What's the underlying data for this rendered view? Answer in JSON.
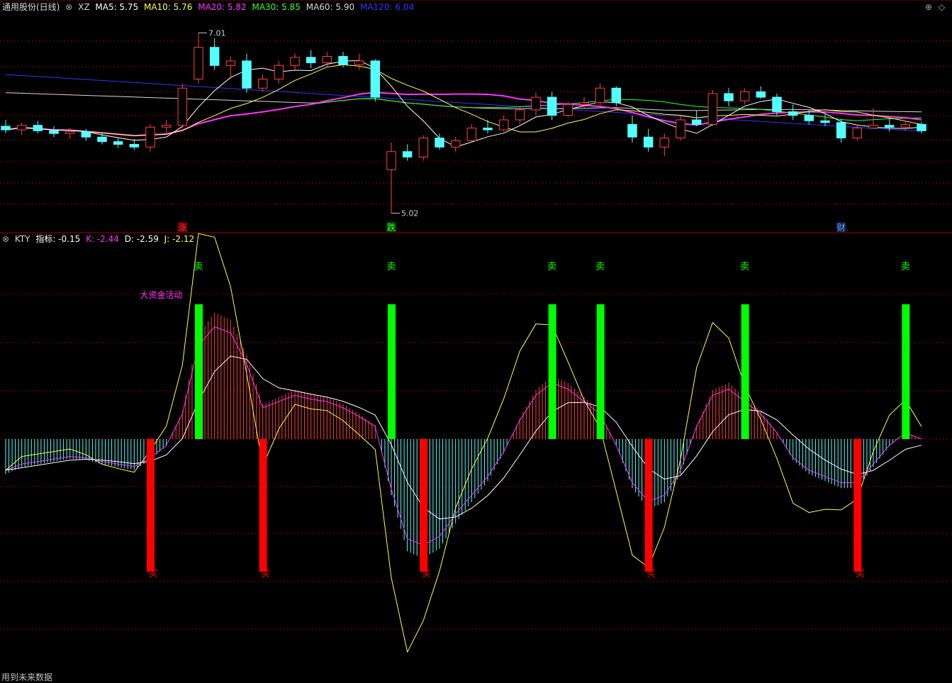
{
  "app": {
    "stock_name": "通用股份(日线)",
    "footer_note": "用到未来数据"
  },
  "main_header": {
    "close_glyph": "⊗",
    "indicator": "XZ",
    "mas": [
      {
        "label": "MA5: 5.75",
        "color": "#ffffff"
      },
      {
        "label": "MA10: 5.76",
        "color": "#ffff44"
      },
      {
        "label": "MA20: 5.82",
        "color": "#ff33ff"
      },
      {
        "label": "MA30: 5.85",
        "color": "#33ff33"
      },
      {
        "label": "MA60: 5.90",
        "color": "#d8d8d8"
      },
      {
        "label": "MA120: 6.04",
        "color": "#3333ff"
      }
    ],
    "corner_icons": [
      "⊕",
      "◇"
    ]
  },
  "price_annotations": {
    "high": "7.01",
    "low": "5.02"
  },
  "event_markers": [
    {
      "label": "涨",
      "color": "#ff3333",
      "bg": "#5a0000",
      "index": 11
    },
    {
      "label": "跌",
      "color": "#33ff33",
      "bg": "#004400",
      "index": 24
    },
    {
      "label": "财",
      "color": "#66aaff",
      "bg": "#0a1f44",
      "index": 52
    }
  ],
  "indicator_header": {
    "close_glyph": "⊗",
    "name": "KTY",
    "fields": [
      {
        "label": "指标: -0.15",
        "color": "#ffffff"
      },
      {
        "label": "K: -2.44",
        "color": "#ff33ff"
      },
      {
        "label": "D: -2.59",
        "color": "#ffffff"
      },
      {
        "label": "J: -2.12",
        "color": "#ffff44"
      }
    ]
  },
  "big_capital_label": "大资金活动",
  "signals": {
    "sell_label": "卖",
    "buy_label": "买",
    "sell_at": [
      12,
      24,
      34,
      37,
      46,
      56
    ],
    "buy_at": [
      9,
      16,
      26,
      40,
      53
    ]
  },
  "colors": {
    "up": "#ff4040",
    "down": "#54ffff",
    "grid": "#8b0000",
    "sell_bar": "#00ff00",
    "buy_bar": "#ff0000",
    "big_capital": "#ff33ff"
  },
  "chart_data": {
    "type": "candlestick",
    "ylim": [
      4.9,
      7.2
    ],
    "candles": [
      {
        "o": 5.98,
        "h": 6.05,
        "l": 5.9,
        "c": 5.94
      },
      {
        "o": 5.94,
        "h": 6.02,
        "l": 5.88,
        "c": 5.99
      },
      {
        "o": 5.99,
        "h": 6.04,
        "l": 5.9,
        "c": 5.93
      },
      {
        "o": 5.93,
        "h": 5.98,
        "l": 5.86,
        "c": 5.9
      },
      {
        "o": 5.9,
        "h": 5.96,
        "l": 5.84,
        "c": 5.92
      },
      {
        "o": 5.92,
        "h": 5.95,
        "l": 5.82,
        "c": 5.86
      },
      {
        "o": 5.86,
        "h": 5.9,
        "l": 5.78,
        "c": 5.81
      },
      {
        "o": 5.81,
        "h": 5.86,
        "l": 5.74,
        "c": 5.78
      },
      {
        "o": 5.78,
        "h": 5.84,
        "l": 5.72,
        "c": 5.75
      },
      {
        "o": 5.75,
        "h": 6.0,
        "l": 5.7,
        "c": 5.97
      },
      {
        "o": 5.97,
        "h": 6.05,
        "l": 5.9,
        "c": 5.99
      },
      {
        "o": 5.99,
        "h": 6.45,
        "l": 5.96,
        "c": 6.4
      },
      {
        "o": 6.5,
        "h": 7.01,
        "l": 6.45,
        "c": 6.85
      },
      {
        "o": 6.85,
        "h": 6.95,
        "l": 6.6,
        "c": 6.65
      },
      {
        "o": 6.65,
        "h": 6.75,
        "l": 6.5,
        "c": 6.7
      },
      {
        "o": 6.7,
        "h": 6.78,
        "l": 6.35,
        "c": 6.4
      },
      {
        "o": 6.4,
        "h": 6.55,
        "l": 6.36,
        "c": 6.5
      },
      {
        "o": 6.5,
        "h": 6.7,
        "l": 6.45,
        "c": 6.65
      },
      {
        "o": 6.65,
        "h": 6.78,
        "l": 6.6,
        "c": 6.74
      },
      {
        "o": 6.74,
        "h": 6.82,
        "l": 6.62,
        "c": 6.68
      },
      {
        "o": 6.68,
        "h": 6.8,
        "l": 6.64,
        "c": 6.75
      },
      {
        "o": 6.75,
        "h": 6.8,
        "l": 6.63,
        "c": 6.66
      },
      {
        "o": 6.66,
        "h": 6.78,
        "l": 6.6,
        "c": 6.7
      },
      {
        "o": 6.7,
        "h": 6.72,
        "l": 6.25,
        "c": 6.3
      },
      {
        "o": 5.5,
        "h": 5.8,
        "l": 5.02,
        "c": 5.7
      },
      {
        "o": 5.7,
        "h": 5.78,
        "l": 5.6,
        "c": 5.64
      },
      {
        "o": 5.64,
        "h": 5.88,
        "l": 5.6,
        "c": 5.85
      },
      {
        "o": 5.85,
        "h": 5.9,
        "l": 5.72,
        "c": 5.75
      },
      {
        "o": 5.75,
        "h": 5.86,
        "l": 5.7,
        "c": 5.82
      },
      {
        "o": 5.82,
        "h": 6.0,
        "l": 5.8,
        "c": 5.96
      },
      {
        "o": 5.96,
        "h": 6.05,
        "l": 5.9,
        "c": 5.94
      },
      {
        "o": 5.94,
        "h": 6.1,
        "l": 5.92,
        "c": 6.05
      },
      {
        "o": 6.05,
        "h": 6.2,
        "l": 6.0,
        "c": 6.16
      },
      {
        "o": 6.16,
        "h": 6.35,
        "l": 6.1,
        "c": 6.3
      },
      {
        "o": 6.3,
        "h": 6.36,
        "l": 6.05,
        "c": 6.1
      },
      {
        "o": 6.1,
        "h": 6.25,
        "l": 6.08,
        "c": 6.22
      },
      {
        "o": 6.22,
        "h": 6.3,
        "l": 6.18,
        "c": 6.24
      },
      {
        "o": 6.24,
        "h": 6.45,
        "l": 6.2,
        "c": 6.4
      },
      {
        "o": 6.4,
        "h": 6.42,
        "l": 6.2,
        "c": 6.24
      },
      {
        "o": 6.0,
        "h": 6.1,
        "l": 5.8,
        "c": 5.86
      },
      {
        "o": 5.86,
        "h": 5.95,
        "l": 5.7,
        "c": 5.75
      },
      {
        "o": 5.75,
        "h": 5.9,
        "l": 5.65,
        "c": 5.85
      },
      {
        "o": 5.85,
        "h": 6.1,
        "l": 5.82,
        "c": 6.05
      },
      {
        "o": 6.05,
        "h": 6.15,
        "l": 5.98,
        "c": 6.0
      },
      {
        "o": 6.0,
        "h": 6.38,
        "l": 5.98,
        "c": 6.34
      },
      {
        "o": 6.34,
        "h": 6.4,
        "l": 6.2,
        "c": 6.26
      },
      {
        "o": 6.26,
        "h": 6.4,
        "l": 6.22,
        "c": 6.36
      },
      {
        "o": 6.36,
        "h": 6.42,
        "l": 6.28,
        "c": 6.3
      },
      {
        "o": 6.3,
        "h": 6.34,
        "l": 6.1,
        "c": 6.14
      },
      {
        "o": 6.14,
        "h": 6.22,
        "l": 6.05,
        "c": 6.1
      },
      {
        "o": 6.1,
        "h": 6.16,
        "l": 6.0,
        "c": 6.04
      },
      {
        "o": 6.04,
        "h": 6.12,
        "l": 5.98,
        "c": 6.02
      },
      {
        "o": 6.02,
        "h": 6.06,
        "l": 5.8,
        "c": 5.85
      },
      {
        "o": 5.85,
        "h": 6.0,
        "l": 5.82,
        "c": 5.96
      },
      {
        "o": 5.96,
        "h": 6.18,
        "l": 5.95,
        "c": 5.99
      },
      {
        "o": 5.99,
        "h": 6.06,
        "l": 5.92,
        "c": 5.97
      },
      {
        "o": 5.97,
        "h": 6.04,
        "l": 5.93,
        "c": 6.0
      },
      {
        "o": 6.0,
        "h": 6.03,
        "l": 5.9,
        "c": 5.93
      }
    ]
  }
}
